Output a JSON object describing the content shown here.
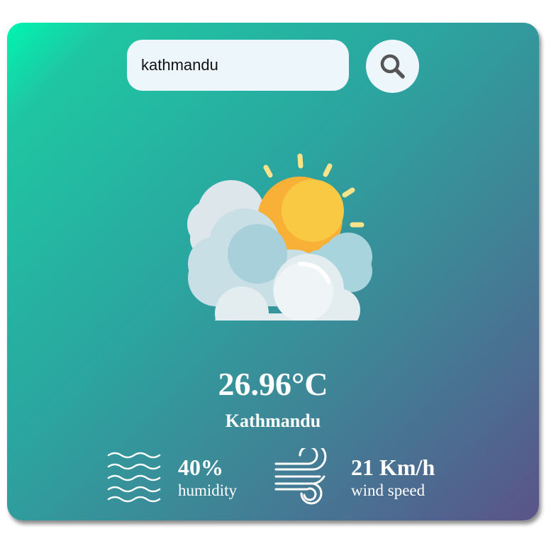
{
  "search": {
    "value": "kathmandu",
    "button_icon": "search-icon"
  },
  "weather": {
    "icon": "partly-cloudy-sun-icon",
    "temperature": "26.96°C",
    "city": "Kathmandu"
  },
  "details": {
    "humidity": {
      "value": "40%",
      "label": "humidity",
      "icon": "humidity-waves-icon"
    },
    "wind": {
      "value": "21 Km/h",
      "label": "wind speed",
      "icon": "wind-icon"
    }
  },
  "colors": {
    "gradient_start": "#00f5b0",
    "gradient_end": "#5b5389",
    "input_bg": "#edf6fb",
    "text": "#ffffff"
  }
}
